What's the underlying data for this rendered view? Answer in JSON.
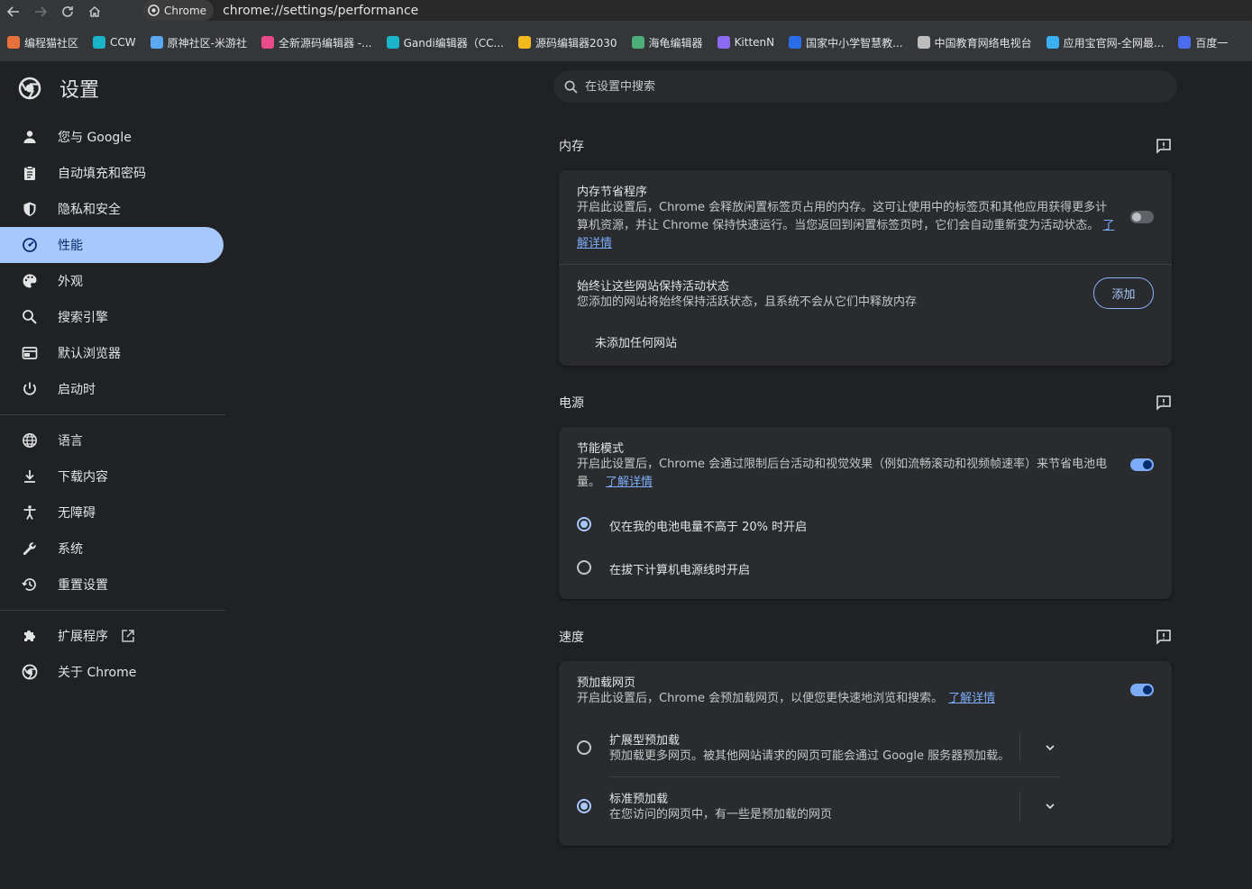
{
  "browser": {
    "chip_label": "Chrome",
    "url": "chrome://settings/performance",
    "bookmarks": [
      {
        "label": "编程猫社区",
        "color": "#e8703a"
      },
      {
        "label": "CCW",
        "color": "#1bb3c8"
      },
      {
        "label": "原神社区-米游社",
        "color": "#5aa9f0"
      },
      {
        "label": "全新源码编辑器 -...",
        "color": "#e84a8a"
      },
      {
        "label": "Gandi编辑器（CC...",
        "color": "#1bb3c8"
      },
      {
        "label": "源码编辑器2030",
        "color": "#f2b81e"
      },
      {
        "label": "海龟编辑器",
        "color": "#4caf7a"
      },
      {
        "label": "KittenN",
        "color": "#8a6af0"
      },
      {
        "label": "国家中小学智慧教...",
        "color": "#2a6de8"
      },
      {
        "label": "中国教育网络电视台",
        "color": "#bdbdbd"
      },
      {
        "label": "应用宝官网-全网最...",
        "color": "#3ab0f0"
      },
      {
        "label": "百度一",
        "color": "#4a6cf0"
      }
    ]
  },
  "sidebar": {
    "title": "设置",
    "items": [
      {
        "label": "您与 Google",
        "icon": "person-icon"
      },
      {
        "label": "自动填充和密码",
        "icon": "clipboard-icon"
      },
      {
        "label": "隐私和安全",
        "icon": "shield-icon"
      },
      {
        "label": "性能",
        "icon": "speedometer-icon"
      },
      {
        "label": "外观",
        "icon": "palette-icon"
      },
      {
        "label": "搜索引擎",
        "icon": "search-icon"
      },
      {
        "label": "默认浏览器",
        "icon": "browser-icon"
      },
      {
        "label": "启动时",
        "icon": "power-icon"
      }
    ],
    "items2": [
      {
        "label": "语言",
        "icon": "globe-icon"
      },
      {
        "label": "下载内容",
        "icon": "download-icon"
      },
      {
        "label": "无障碍",
        "icon": "accessibility-icon"
      },
      {
        "label": "系统",
        "icon": "wrench-icon"
      },
      {
        "label": "重置设置",
        "icon": "history-icon"
      }
    ],
    "items3": [
      {
        "label": "扩展程序",
        "icon": "puzzle-icon"
      },
      {
        "label": "关于 Chrome",
        "icon": "chrome-icon"
      }
    ]
  },
  "search": {
    "placeholder": "在设置中搜索"
  },
  "memory": {
    "title": "内存",
    "saver_title": "内存节省程序",
    "saver_desc1": "开启此设置后，Chrome 会释放闲置标签页占用的内存。这可让使用中的标签页和其他应用获得更多计",
    "saver_desc2": "算机资源，并让 Chrome 保持快速运行。当您返回到闲置标签页时，它们会自动重新变为活动状态。",
    "saver_link_a": "了",
    "saver_link_b": "解详情",
    "saver_enabled": false,
    "keep_title": "始终让这些网站保持活动状态",
    "keep_desc": "您添加的网站将始终保持活跃状态，且系统不会从它们中释放内存",
    "add_label": "添加",
    "empty_label": "未添加任何网站"
  },
  "power": {
    "title": "电源",
    "energy_title": "节能模式",
    "energy_desc1": "开启此设置后，Chrome 会通过限制后台活动和视觉效果（例如流畅滚动和视频帧速率）来节省电池电",
    "energy_desc2": "量。",
    "energy_link": "了解详情",
    "energy_enabled": true,
    "option1": "仅在我的电池电量不高于 20% 时开启",
    "option2": "在拔下计算机电源线时开启"
  },
  "speed": {
    "title": "速度",
    "preload_title": "预加载网页",
    "preload_desc": "开启此设置后，Chrome 会预加载网页，以便您更快速地浏览和搜索。",
    "preload_link": "了解详情",
    "preload_enabled": true,
    "ext_title": "扩展型预加载",
    "ext_desc": "预加载更多网页。被其他网站请求的网页可能会通过 Google 服务器预加载。",
    "std_title": "标准预加载",
    "std_desc": "在您访问的网页中，有一些是预加载的网页"
  }
}
